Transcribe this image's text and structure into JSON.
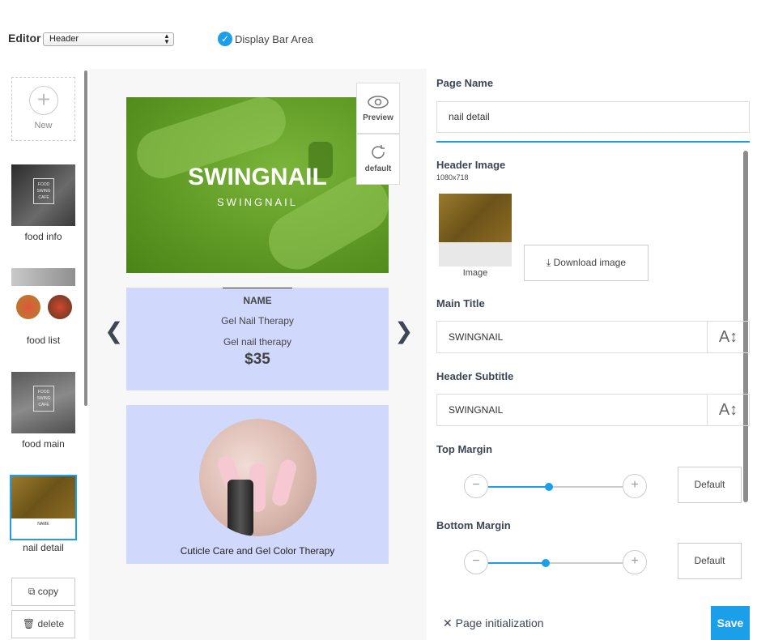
{
  "toolbar": {
    "editor_label": "Editor",
    "section_value": "Header",
    "display_bar_label": "Display Bar Area",
    "display_bar_checked": true
  },
  "pages": {
    "new_label": "New",
    "items": [
      {
        "label": "food info"
      },
      {
        "label": "food list"
      },
      {
        "label": "food main"
      },
      {
        "label": "nail detail",
        "selected": true
      }
    ],
    "copy_label": "copy",
    "delete_label": "delete"
  },
  "preview": {
    "preview_button": "Preview",
    "default_button": "default",
    "hero_title": "SWINGNAIL",
    "hero_subtitle": "SWINGNAIL",
    "price_name": "NAME",
    "price_title": "Gel Nail Therapy",
    "price_subtitle": "Gel nail therapy",
    "price_value": "$35",
    "product_caption": "Cuticle Care and Gel Color Therapy"
  },
  "panel": {
    "page_name_title": "Page Name",
    "page_name_value": "nail detail",
    "header_image_title": "Header Image",
    "header_image_size": "1080x718",
    "image_label": "Image",
    "download_label": "Download image",
    "main_title_label": "Main Title",
    "main_title_value": "SWINGNAIL",
    "subtitle_label": "Header Subtitle",
    "subtitle_value": "SWINGNAIL",
    "top_margin_label": "Top Margin",
    "top_margin_level": 0.45,
    "bottom_margin_label": "Bottom Margin",
    "bottom_margin_level": 0.43,
    "default_label": "Default",
    "init_label": "Page initialization",
    "save_label": "Save"
  },
  "colors": {
    "accent": "#1a9fe8",
    "card_bg": "#d0d9fb",
    "heading": "#3d4655"
  }
}
